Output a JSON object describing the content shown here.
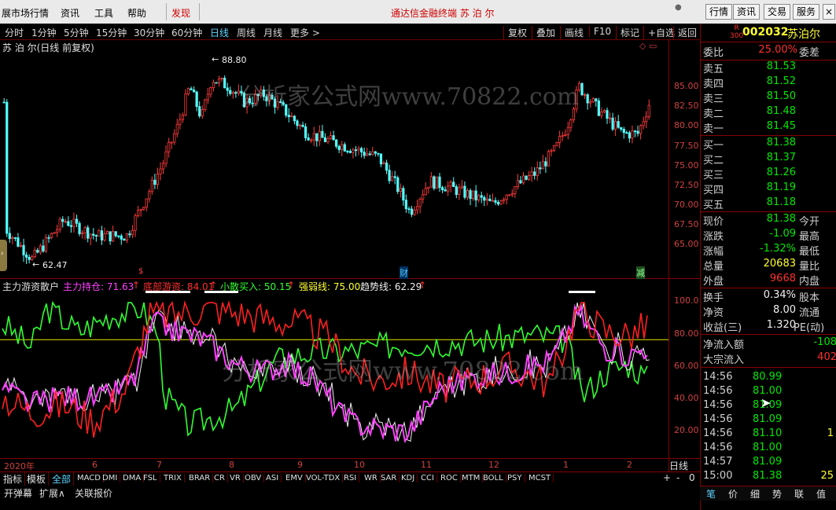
{
  "menu": {
    "items": [
      "展市场行情",
      "资讯",
      "工具",
      "帮助",
      "发现"
    ],
    "title": "通达信金融终端  苏 泊 尔",
    "right_buttons": [
      "行情",
      "资讯",
      "交易",
      "服务"
    ]
  },
  "periods": {
    "items": [
      "分时",
      "1分钟",
      "5分钟",
      "15分钟",
      "30分钟",
      "60分钟",
      "日线",
      "周线",
      "月线",
      "更多 >"
    ],
    "active": "日线",
    "tools": [
      "复权",
      "叠加",
      "画线",
      "F10",
      "标记",
      "+自选",
      "返回"
    ]
  },
  "price_chart": {
    "title": "苏 泊 尔(日线 前复权)",
    "high_label": "88.80",
    "low_label": "62.47",
    "y_ticks": [
      "85.00",
      "82.50",
      "80.00",
      "77.50",
      "75.00",
      "72.50",
      "70.00",
      "67.50",
      "65.00"
    ],
    "markers": [
      "财",
      "减"
    ]
  },
  "indicator": {
    "name": "主力游资散户",
    "items": [
      {
        "label": "主力持仓: 71.63",
        "color": "#ff40ff"
      },
      {
        "label": "底部游资: 84.01",
        "color": "#ff3030"
      },
      {
        "label": "小散买入: 50.15",
        "color": "#30ff30"
      },
      {
        "label": "强弱线: 75.00",
        "color": "#ffff30"
      },
      {
        "label": "趋势线: 62.29",
        "color": "#f0f0f0"
      }
    ],
    "y_ticks": [
      "100.0",
      "80.00",
      "60.00",
      "40.00",
      "20.00"
    ]
  },
  "dates": [
    "2020年",
    "6",
    "7",
    "8",
    "9",
    "10",
    "11",
    "12",
    "1",
    "2"
  ],
  "period_label": "日线",
  "zoom_controls": [
    "+",
    "-",
    "0"
  ],
  "tabs": {
    "items": [
      "指标",
      "模板",
      "全部",
      "MACD",
      "DMI",
      "DMA",
      "FSL",
      "TRIX",
      "BRAR",
      "CR",
      "VR",
      "OBV",
      "ASI",
      "EMV",
      "VOL-TDX",
      "RSI",
      "WR",
      "SAR",
      "KDJ",
      "CCI",
      "ROC",
      "MTM",
      "BOLL",
      "PSY",
      "MCST"
    ],
    "active": "全部"
  },
  "footer": [
    "开弹幕",
    "扩展∧",
    "关联报价"
  ],
  "quote": {
    "r_badge": "R",
    "r_num": "300",
    "code": "002032",
    "name": "苏泊尔",
    "weibi": {
      "label": "委比",
      "value": "25.00%",
      "right": "委差"
    },
    "asks": [
      {
        "label": "卖五",
        "value": "81.53"
      },
      {
        "label": "卖四",
        "value": "81.52"
      },
      {
        "label": "卖三",
        "value": "81.50"
      },
      {
        "label": "卖二",
        "value": "81.48"
      },
      {
        "label": "卖一",
        "value": "81.45"
      }
    ],
    "bids": [
      {
        "label": "买一",
        "value": "81.38"
      },
      {
        "label": "买二",
        "value": "81.37"
      },
      {
        "label": "买三",
        "value": "81.26"
      },
      {
        "label": "买四",
        "value": "81.19"
      },
      {
        "label": "买五",
        "value": "81.18"
      }
    ],
    "stats": [
      {
        "label": "现价",
        "value": "81.38",
        "right": "今开",
        "color": "green"
      },
      {
        "label": "涨跌",
        "value": "-1.09",
        "right": "最高",
        "color": "green"
      },
      {
        "label": "涨幅",
        "value": "-1.32%",
        "right": "最低",
        "color": "green"
      },
      {
        "label": "总量",
        "value": "20683",
        "right": "量比",
        "color": "yellow"
      },
      {
        "label": "外盘",
        "value": "9668",
        "right": "内盘",
        "color": "red"
      }
    ],
    "fin": [
      {
        "label": "换手",
        "value": "0.34%",
        "right": "股本"
      },
      {
        "label": "净资",
        "value": "8.00",
        "right": "流通"
      },
      {
        "label": "收益(三)",
        "value": "1.320",
        "right": "PE(动)"
      }
    ],
    "flow": [
      {
        "label": "净流入额",
        "value": "-108",
        "color": "green"
      },
      {
        "label": "大宗流入",
        "value": "402",
        "color": "red"
      }
    ],
    "ticks": [
      {
        "time": "14:56",
        "price": "80.99",
        "vol": ""
      },
      {
        "time": "14:56",
        "price": "81.00",
        "vol": ""
      },
      {
        "time": "14:56",
        "price": "81.09",
        "vol": ""
      },
      {
        "time": "14:56",
        "price": "81.09",
        "vol": ""
      },
      {
        "time": "14:56",
        "price": "81.10",
        "vol": "1"
      },
      {
        "time": "14:56",
        "price": "81.00",
        "vol": ""
      },
      {
        "time": "14:57",
        "price": "81.09",
        "vol": ""
      },
      {
        "time": "15:00",
        "price": "81.38",
        "vol": "25"
      }
    ]
  },
  "right_tabs": [
    "笔",
    "价",
    "细",
    "势",
    "联",
    "值"
  ],
  "watermark": "分析家公式网www.70822.com"
}
